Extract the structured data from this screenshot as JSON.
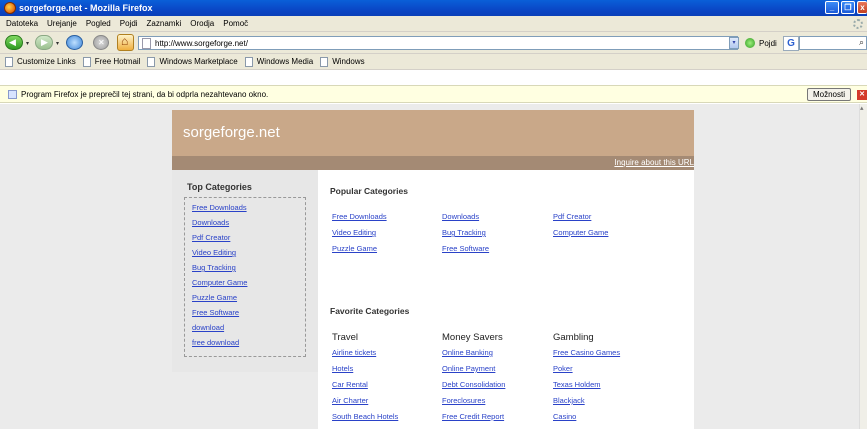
{
  "window": {
    "title": "sorgeforge.net - Mozilla Firefox"
  },
  "menu": [
    "Datoteka",
    "Urejanje",
    "Pogled",
    "Pojdi",
    "Zaznamki",
    "Orodja",
    "Pomoč"
  ],
  "nav": {
    "url": "http://www.sorgeforge.net/",
    "go_label": "Pojdi",
    "search_label": "G"
  },
  "bookmarks": [
    "Customize Links",
    "Free Hotmail",
    "Windows Marketplace",
    "Windows Media",
    "Windows"
  ],
  "notification": {
    "text": "Program Firefox je preprečil tej strani, da bi odprla nezahtevano okno.",
    "button": "Možnosti"
  },
  "site": {
    "title": "sorgeforge.net",
    "inquire": "Inquire about this URL",
    "top_categories": {
      "title": "Top Categories",
      "links": [
        "Free Downloads",
        "Downloads",
        "Pdf Creator",
        "Video Editing",
        "Bug Tracking",
        "Computer Game",
        "Puzzle Game",
        "Free Software",
        "download",
        "free download"
      ]
    },
    "popular": {
      "title": "Popular Categories",
      "links": [
        "Free Downloads",
        "Downloads",
        "Pdf Creator",
        "Video Editing",
        "Bug Tracking",
        "Computer Game",
        "Puzzle Game",
        "Free Software"
      ]
    },
    "favorite": {
      "title": "Favorite Categories",
      "columns": [
        {
          "heading": "Travel",
          "links": [
            "Airline tickets",
            "Hotels",
            "Car Rental",
            "Air Charter",
            "South Beach Hotels"
          ]
        },
        {
          "heading": "Money Savers",
          "links": [
            "Online Banking",
            "Online Payment",
            "Debt Consolidation",
            "Foreclosures",
            "Free Credit Report"
          ]
        },
        {
          "heading": "Gambling",
          "links": [
            "Free Casino Games",
            "Poker",
            "Texas Holdem",
            "Blackjack",
            "Casino"
          ]
        }
      ]
    }
  },
  "colors": {
    "header_bg": "#c9a889",
    "strip_bg": "#a48a74",
    "link": "#2a42c8",
    "page_bg": "#ebebeb"
  }
}
